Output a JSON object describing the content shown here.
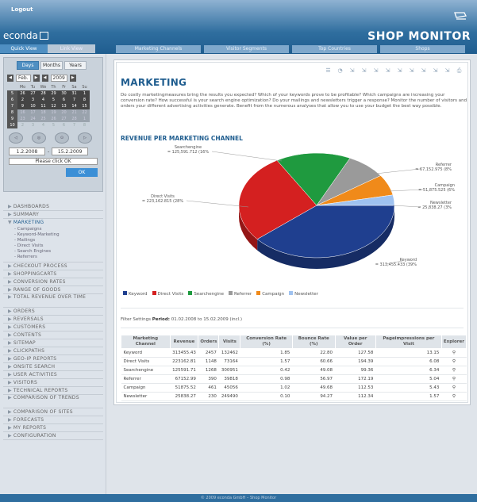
{
  "header": {
    "logout": "Logout",
    "brand": "econda",
    "title": "SHOP MONITOR",
    "view_tabs": [
      "Quick View",
      "Link View"
    ],
    "main_tabs": [
      "Marketing Channels",
      "Visitor Segments",
      "Top Countries",
      "Shops"
    ]
  },
  "calendar": {
    "range_tabs": [
      "Days",
      "Months",
      "Years"
    ],
    "month": "Feb.",
    "year": "2009",
    "weekday_header": [
      "Mo",
      "Tu",
      "We",
      "Th",
      "Fr",
      "Sa",
      "Su"
    ],
    "weeks": [
      {
        "wk": "5",
        "days": [
          "26",
          "27",
          "28",
          "29",
          "30",
          "31",
          "1"
        ],
        "style": "d"
      },
      {
        "wk": "6",
        "days": [
          "2",
          "3",
          "4",
          "5",
          "6",
          "7",
          "8"
        ],
        "style": "d"
      },
      {
        "wk": "7",
        "days": [
          "9",
          "10",
          "11",
          "12",
          "13",
          "14",
          "15"
        ],
        "style": "d"
      },
      {
        "wk": "8",
        "days": [
          "16",
          "17",
          "18",
          "19",
          "20",
          "21",
          "22"
        ],
        "style": "faded"
      },
      {
        "wk": "9",
        "days": [
          "23",
          "24",
          "25",
          "26",
          "27",
          "28",
          "1"
        ],
        "style": "faded"
      },
      {
        "wk": "10",
        "days": [
          "2",
          "3",
          "4",
          "5",
          "6",
          "7",
          "8"
        ],
        "style": "blank"
      }
    ],
    "round_icons": [
      "◁",
      "◎",
      "⊙",
      "▷"
    ],
    "date_from": "1.2.2008",
    "date_to": "15.2.2009",
    "date_sep": "-",
    "hint": "Please click OK",
    "ok": "OK"
  },
  "nav": {
    "items": [
      {
        "label": "DASHBOARDS"
      },
      {
        "label": "SUMMARY"
      },
      {
        "label": "MARKETING",
        "open": true,
        "sub": [
          "Campaigns",
          "Keyword-Marketing",
          "Mailings",
          "Direct Visits",
          "Search Engines",
          "Referrers"
        ]
      },
      {
        "label": "CHECKOUT PROCESS"
      },
      {
        "label": "SHOPPINGCARTS"
      },
      {
        "label": "CONVERSION RATES"
      },
      {
        "label": "RANGE OF GOODS"
      },
      {
        "label": "TOTAL REVENUE OVER TIME",
        "two": true
      },
      {
        "label": "ORDERS"
      },
      {
        "label": "REVERSALS"
      },
      {
        "label": "CUSTOMERS"
      },
      {
        "label": "CONTENTS"
      },
      {
        "label": "SITEMAP"
      },
      {
        "label": "CLICKPATHS"
      },
      {
        "label": "GEO-IP REPORTS"
      },
      {
        "label": "ONSITE SEARCH"
      },
      {
        "label": "USER ACTIVITIES"
      },
      {
        "label": "VISITORS"
      },
      {
        "label": "TECHNICAL REPORTS"
      },
      {
        "label": "COMPARISON OF TRENDS",
        "two": true
      },
      {
        "label": "COMPARISON OF SITES"
      },
      {
        "label": "FORECASTS"
      },
      {
        "label": "MY REPORTS"
      },
      {
        "label": "CONFIGURATION"
      }
    ]
  },
  "main": {
    "title": "MARKETING",
    "intro": "Do costly marketingmeasures bring the results you expected? Which of your keywords prove to be profitable? Which campaigns are increasing your conversion rate? How successful is your search engine optimization? Do your mailings and newsletters trigger a response? Monitor the number of visitors and orders your different advertising activities generate. Benefit from the numerous analyses that allow you to use your budget the best way possible.",
    "chart_title": "REVENUE PER MARKETING CHANNEL",
    "filter_label": "Filter Settings",
    "filter_period_label": "Period:",
    "filter_period": "01.02.2008 to 15.02.2009 (incl.)",
    "toolbar_icons": [
      "list-icon",
      "chart-icon",
      "export-icon",
      "export-icon",
      "export-icon",
      "export-icon",
      "export-icon",
      "export-icon",
      "export-icon",
      "export-icon",
      "export-icon",
      "print-icon"
    ]
  },
  "chart_data": {
    "type": "pie",
    "title": "REVENUE PER MARKETING CHANNEL",
    "series": [
      {
        "name": "Keyword",
        "value": 313455.43,
        "label": "Keyword\n= 313,455.433 (39%",
        "color": "#1f3f8f"
      },
      {
        "name": "Direct Visits",
        "value": 223162.81,
        "label": "Direct Visits\n= 223,162.815 (28%",
        "color": "#d42020"
      },
      {
        "name": "Searchengine",
        "value": 125591.71,
        "label": "Searchengine\n= 125,591.712 (16%",
        "color": "#1f9a3f"
      },
      {
        "name": "Referrer",
        "value": 67152.99,
        "label": "Referrer\n= 67,152.975 (8%",
        "color": "#9a9a9a"
      },
      {
        "name": "Campaign",
        "value": 51875.52,
        "label": "Campaign\n= 51,875.525 (6%",
        "color": "#f08a1a"
      },
      {
        "name": "Newsletter",
        "value": 25838.27,
        "label": "Newsletter\n= 25,838.27 (3%",
        "color": "#9fc2f0"
      }
    ]
  },
  "table": {
    "headers": [
      "Marketing Channel",
      "Revenue",
      "Orders",
      "Visits",
      "Conversion Rate (%)",
      "Bounce Rate (%)",
      "Value per Order",
      "Pageimpressions per Visit",
      "Explorer"
    ],
    "rows": [
      [
        "Keyword",
        "313455.43",
        "2457",
        "132462",
        "1.85",
        "22.80",
        "127.58",
        "13.15"
      ],
      [
        "Direct Visits",
        "223162.81",
        "1148",
        "73164",
        "1.57",
        "60.66",
        "194.39",
        "6.08"
      ],
      [
        "Searchengine",
        "125591.71",
        "1268",
        "300951",
        "0.42",
        "49.08",
        "99.36",
        "6.34"
      ],
      [
        "Referrer",
        "67152.99",
        "390",
        "39818",
        "0.98",
        "56.97",
        "172.19",
        "5.04"
      ],
      [
        "Campaign",
        "51875.52",
        "461",
        "45056",
        "1.02",
        "49.68",
        "112.53",
        "5.43"
      ],
      [
        "Newsletter",
        "25838.27",
        "230",
        "249490",
        "0.10",
        "94.27",
        "112.34",
        "1.57"
      ]
    ]
  },
  "footer": {
    "text": "© 2009 econda GmbH – Shop Monitor"
  }
}
